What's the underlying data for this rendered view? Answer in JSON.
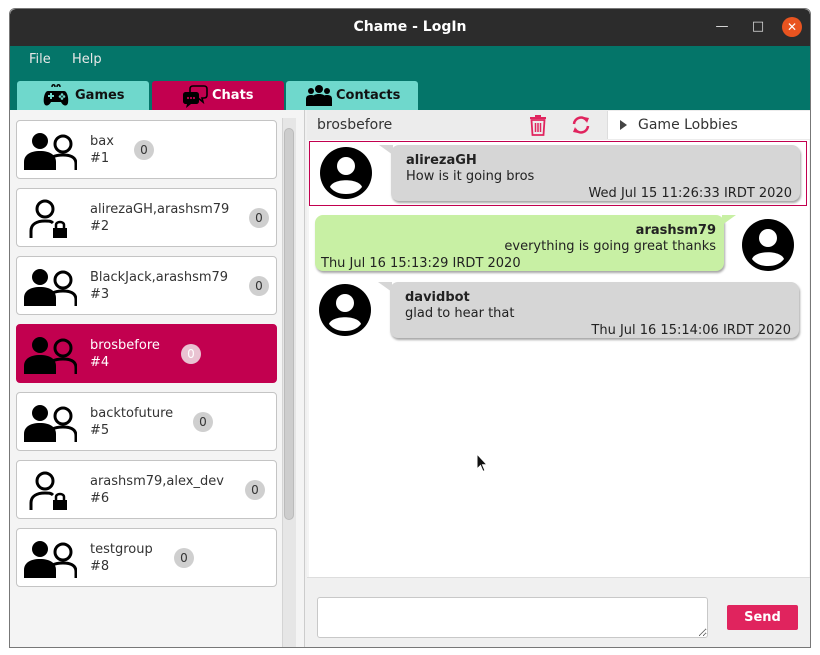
{
  "window": {
    "title": "Chame - LogIn"
  },
  "menu": {
    "file": "File",
    "help": "Help"
  },
  "tabs": [
    {
      "label": "Games",
      "icon": "gamepad-icon",
      "active": false
    },
    {
      "label": "Chats",
      "icon": "chat-bubbles-icon",
      "active": true
    },
    {
      "label": "Contacts",
      "icon": "people-icon",
      "active": false
    }
  ],
  "chats": [
    {
      "name": "bax",
      "number": "#1",
      "unread": "0",
      "icon": "group-icon",
      "selected": false
    },
    {
      "name": "alirezaGH,arashsm79",
      "number": "#2",
      "unread": "0",
      "icon": "private-user-lock-icon",
      "selected": false
    },
    {
      "name": "BlackJack,arashsm79",
      "number": "#3",
      "unread": "0",
      "icon": "group-icon",
      "selected": false
    },
    {
      "name": "brosbefore",
      "number": "#4",
      "unread": "0",
      "icon": "group-icon",
      "selected": true
    },
    {
      "name": "backtofuture",
      "number": "#5",
      "unread": "0",
      "icon": "group-icon",
      "selected": false
    },
    {
      "name": "arashsm79,alex_dev",
      "number": "#6",
      "unread": "0",
      "icon": "private-user-lock-icon",
      "selected": false
    },
    {
      "name": "testgroup",
      "number": "#8",
      "unread": "0",
      "icon": "group-icon",
      "selected": false
    }
  ],
  "chat_header": {
    "title": "brosbefore",
    "lobbies_label": "Game Lobbies"
  },
  "messages": [
    {
      "sender": "alirezaGH",
      "text": "How is it going bros",
      "time": "Wed Jul 15 11:26:33 IRDT 2020",
      "mine": false
    },
    {
      "sender": "arashsm79",
      "text": "everything is going great thanks",
      "time": "Thu Jul 16 15:13:29 IRDT 2020",
      "mine": true
    },
    {
      "sender": "davidbot",
      "text": "glad to hear that",
      "time": "Thu Jul 16 15:14:06 IRDT 2020",
      "mine": false
    }
  ],
  "composer": {
    "value": "",
    "send_label": "Send"
  },
  "colors": {
    "accent": "#c2004f",
    "teal": "#047569",
    "tab": "#6fd8cc",
    "own_bubble": "#c8f0a4",
    "other_bubble": "#d6d6d6",
    "send": "#e0245e"
  }
}
